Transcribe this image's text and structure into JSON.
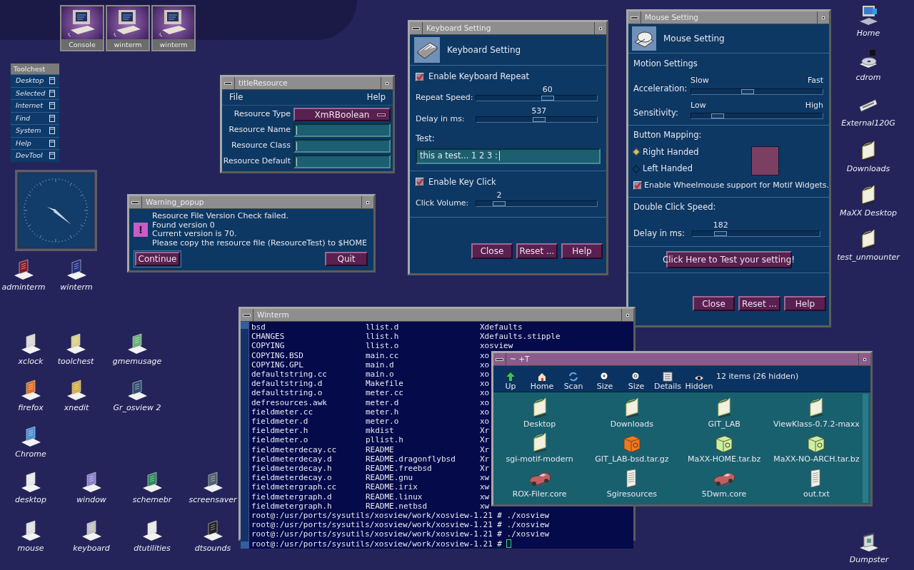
{
  "top_panel": {
    "launchers": [
      {
        "label": "Console"
      },
      {
        "label": "winterm"
      },
      {
        "label": "winterm"
      }
    ]
  },
  "toolchest": {
    "title": "Toolchest",
    "items": [
      {
        "label": "Desktop"
      },
      {
        "label": "Selected"
      },
      {
        "label": "Internet"
      },
      {
        "label": "Find"
      },
      {
        "label": "System"
      },
      {
        "label": "Help"
      },
      {
        "label": "DevTool"
      }
    ]
  },
  "desktop_icons": [
    {
      "label": "adminterm",
      "kind": "app"
    },
    {
      "label": "winterm",
      "kind": "app"
    },
    {
      "label": "xclock",
      "kind": "app"
    },
    {
      "label": "toolchest",
      "kind": "app"
    },
    {
      "label": "gmemusage",
      "kind": "app"
    },
    {
      "label": "firefox",
      "kind": "app"
    },
    {
      "label": "xnedit",
      "kind": "app"
    },
    {
      "label": "Gr_osview 2",
      "kind": "app"
    },
    {
      "label": "Chrome",
      "kind": "app"
    },
    {
      "label": "desktop",
      "kind": "app"
    },
    {
      "label": "window",
      "kind": "app"
    },
    {
      "label": "schemebr",
      "kind": "app"
    },
    {
      "label": "screensaver",
      "kind": "app"
    },
    {
      "label": "mouse",
      "kind": "app"
    },
    {
      "label": "keyboard",
      "kind": "app"
    },
    {
      "label": "dtutilities",
      "kind": "app"
    },
    {
      "label": "dtsounds",
      "kind": "app"
    },
    {
      "label": "Home",
      "kind": "computer"
    },
    {
      "label": "cdrom",
      "kind": "disc"
    },
    {
      "label": "External120G",
      "kind": "drive"
    },
    {
      "label": "Downloads",
      "kind": "folder"
    },
    {
      "label": "MaXX Desktop",
      "kind": "folder"
    },
    {
      "label": "test_unmounter",
      "kind": "folder"
    },
    {
      "label": "Dumpster",
      "kind": "trash"
    }
  ],
  "title_resource": {
    "title": "titleResource",
    "menu": [
      "File",
      "Help"
    ],
    "fields": [
      {
        "label": "Resource Type",
        "kind": "option",
        "value": "XmRBoolean"
      },
      {
        "label": "Resource Name",
        "kind": "text"
      },
      {
        "label": "Resource Class",
        "kind": "text"
      },
      {
        "label": "Resource Default",
        "kind": "text"
      }
    ]
  },
  "warning_popup": {
    "title": "Warning_popup",
    "icon": "!",
    "lines": [
      "Resource File Version Check failed.",
      "Found version 0",
      "Current version is 70.",
      "Please copy the resource file (ResourceTest) to $HOME"
    ],
    "buttons": [
      "Continue",
      "Quit"
    ]
  },
  "keyboard_setting": {
    "title": "Keyboard Setting",
    "heading": "Keyboard Setting",
    "repeat": {
      "label": "Enable Keyboard Repeat",
      "checked": true
    },
    "sliders": [
      {
        "label": "Repeat Speed:",
        "reading": "60",
        "level": 0.59
      },
      {
        "label": "Delay in ms:",
        "reading": "537",
        "level": 0.52
      }
    ],
    "test_label": "Test:",
    "test_value": "this a test... 1 2 3 :",
    "click": {
      "label": "Enable Key Click",
      "checked": true
    },
    "click_slider": {
      "label": "Click Volume:",
      "reading": "2",
      "level": 0.19
    },
    "buttons": [
      "Close",
      "Reset ...",
      "Help"
    ]
  },
  "mouse_setting": {
    "title": "Mouse Setting",
    "heading": "Mouse Setting",
    "motion_title": "Motion Settings",
    "motion": [
      {
        "label": "Acceleration:",
        "low": "Slow",
        "high": "Fast",
        "level": 0.43
      },
      {
        "label": "Sensitivity:",
        "low": "Low",
        "high": "High",
        "level": 0.2
      }
    ],
    "mapping_title": "Button Mapping:",
    "handedness": [
      {
        "label": "Right Handed",
        "selected": true
      },
      {
        "label": "Left Handed",
        "selected": false
      }
    ],
    "wheel": {
      "label": "Enable Wheelmouse support for Motif Widgets.",
      "checked": true
    },
    "double_click_title": "Double Click Speed:",
    "double_click": {
      "label": "Delay in ms:",
      "reading": "182",
      "level": 0.22
    },
    "test_button": "Click Here to Test your setting!",
    "buttons": [
      "Close",
      "Reset ...",
      "Help"
    ]
  },
  "winterm": {
    "title": "Winterm",
    "rows": [
      [
        "bsd",
        "llist.d",
        "Xdefaults"
      ],
      [
        "CHANGES",
        "llist.h",
        "Xdefaults.stipple"
      ],
      [
        "COPYING",
        "llist.o",
        "xosview"
      ],
      [
        "COPYING.BSD",
        "main.cc",
        "xo"
      ],
      [
        "COPYING.GPL",
        "main.d",
        "xo"
      ],
      [
        "defaultstring.cc",
        "main.o",
        "xo"
      ],
      [
        "defaultstring.d",
        "Makefile",
        "xo"
      ],
      [
        "defaultstring.o",
        "meter.cc",
        "xo"
      ],
      [
        "defresources.awk",
        "meter.d",
        "xo"
      ],
      [
        "fieldmeter.cc",
        "meter.h",
        "xo"
      ],
      [
        "fieldmeter.d",
        "meter.o",
        "xo"
      ],
      [
        "fieldmeter.h",
        "mkdist",
        "Xr"
      ],
      [
        "fieldmeter.o",
        "pllist.h",
        "Xr"
      ],
      [
        "fieldmeterdecay.cc",
        "README",
        "Xr"
      ],
      [
        "fieldmeterdecay.d",
        "README.dragonflybsd",
        "Xr"
      ],
      [
        "fieldmeterdecay.h",
        "README.freebsd",
        "Xr"
      ],
      [
        "fieldmeterdecay.o",
        "README.gnu",
        "xw"
      ],
      [
        "fieldmetergraph.cc",
        "README.irix",
        "xw"
      ],
      [
        "fieldmetergraph.d",
        "README.linux",
        "xw"
      ],
      [
        "fieldmetergraph.h",
        "README.netbsd",
        "xw"
      ]
    ],
    "prompts": [
      "root@:/usr/ports/sysutils/xosview/work/xosview-1.21 # ./xosview",
      "root@:/usr/ports/sysutils/xosview/work/xosview-1.21 # ./xosview",
      "root@:/usr/ports/sysutils/xosview/work/xosview-1.21 # ./xosview",
      "root@:/usr/ports/sysutils/xosview/work/xosview-1.21 #"
    ]
  },
  "file_manager": {
    "title": "~ +T",
    "toolbar": [
      {
        "label": "Up",
        "kind": "up"
      },
      {
        "label": "Home",
        "kind": "home"
      },
      {
        "label": "Scan",
        "kind": "scan"
      },
      {
        "label": "Size",
        "kind": "zoom_in"
      },
      {
        "label": "Size",
        "kind": "zoom_fit"
      },
      {
        "label": "Details",
        "kind": "details"
      },
      {
        "label": "Hidden",
        "kind": "hidden"
      }
    ],
    "status": "12 items (26 hidden)",
    "items": [
      {
        "label": "Desktop",
        "kind": "folder"
      },
      {
        "label": "Downloads",
        "kind": "folder"
      },
      {
        "label": "GIT_LAB",
        "kind": "folder"
      },
      {
        "label": "ViewKlass-0.7.2-maxx",
        "kind": "folder"
      },
      {
        "label": "sgi-motif-modern",
        "kind": "folder"
      },
      {
        "label": "GIT_LAB-bsd.tar.gz",
        "kind": "archive",
        "color": "#f07820"
      },
      {
        "label": "MaXX-HOME.tar.bz",
        "kind": "archive",
        "color": "#c8f0a0"
      },
      {
        "label": "MaXX-NO-ARCH.tar.bz",
        "kind": "archive",
        "color": "#c8f0a0"
      },
      {
        "label": "ROX-Filer.core",
        "kind": "core"
      },
      {
        "label": "Sgiresources",
        "kind": "text"
      },
      {
        "label": "5Dwm.core",
        "kind": "core"
      },
      {
        "label": "out.txt",
        "kind": "text"
      }
    ]
  }
}
